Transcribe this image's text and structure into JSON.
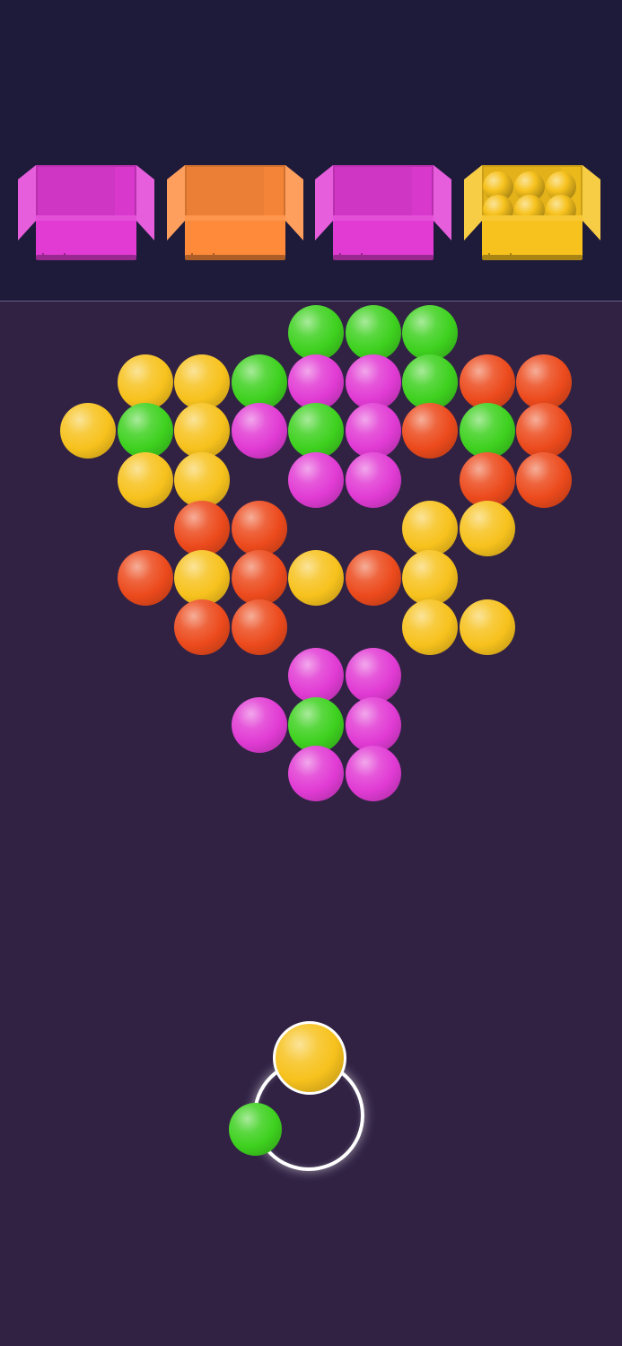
{
  "colors": {
    "yellow": "#f7c21d",
    "green": "#3ed11f",
    "magenta": "#e13bd4",
    "orange": "#ec4a1c",
    "orange_box": "#ff8a3a",
    "background": "#312244",
    "header": "#1e1a3a"
  },
  "boxes": [
    {
      "color": "magenta",
      "filled": 0
    },
    {
      "color": "orange_box",
      "filled": 0
    },
    {
      "color": "magenta",
      "filled": 0
    },
    {
      "color": "yellow",
      "filled": 6
    }
  ],
  "bubble_rows": [
    [
      "_",
      "_",
      "_",
      "_",
      "_",
      "G",
      "G",
      "G",
      "_",
      "_",
      "_",
      "_",
      "_"
    ],
    [
      "_",
      "_",
      "Y",
      "Y",
      "G",
      "M",
      "M",
      "G",
      "O",
      "O",
      "_",
      "_"
    ],
    [
      "_",
      "Y",
      "G",
      "Y",
      "M",
      "G",
      "M",
      "O",
      "G",
      "O",
      "_"
    ],
    [
      "_",
      "_",
      "Y",
      "Y",
      "_",
      "M",
      "M",
      "_",
      "O",
      "O",
      "_",
      "_"
    ],
    [
      "_",
      "_",
      "_",
      "O",
      "O",
      "_",
      "_",
      "Y",
      "Y",
      "_",
      "_",
      "_"
    ],
    [
      "_",
      "_",
      "O",
      "Y",
      "O",
      "Y",
      "O",
      "Y",
      "_",
      "_",
      "_"
    ],
    [
      "_",
      "_",
      "_",
      "O",
      "O",
      "_",
      "_",
      "Y",
      "Y",
      "_",
      "_",
      "_"
    ],
    [
      "_",
      "_",
      "_",
      "_",
      "_",
      "M",
      "M",
      "_",
      "_",
      "_",
      "_",
      "_"
    ],
    [
      "_",
      "_",
      "_",
      "_",
      "M",
      "G",
      "M",
      "_",
      "_",
      "_",
      "_"
    ],
    [
      "_",
      "_",
      "_",
      "_",
      "_",
      "M",
      "M",
      "_",
      "_",
      "_",
      "_",
      "_"
    ]
  ],
  "shooter": {
    "current_ball": "yellow",
    "next_ball": "green"
  }
}
